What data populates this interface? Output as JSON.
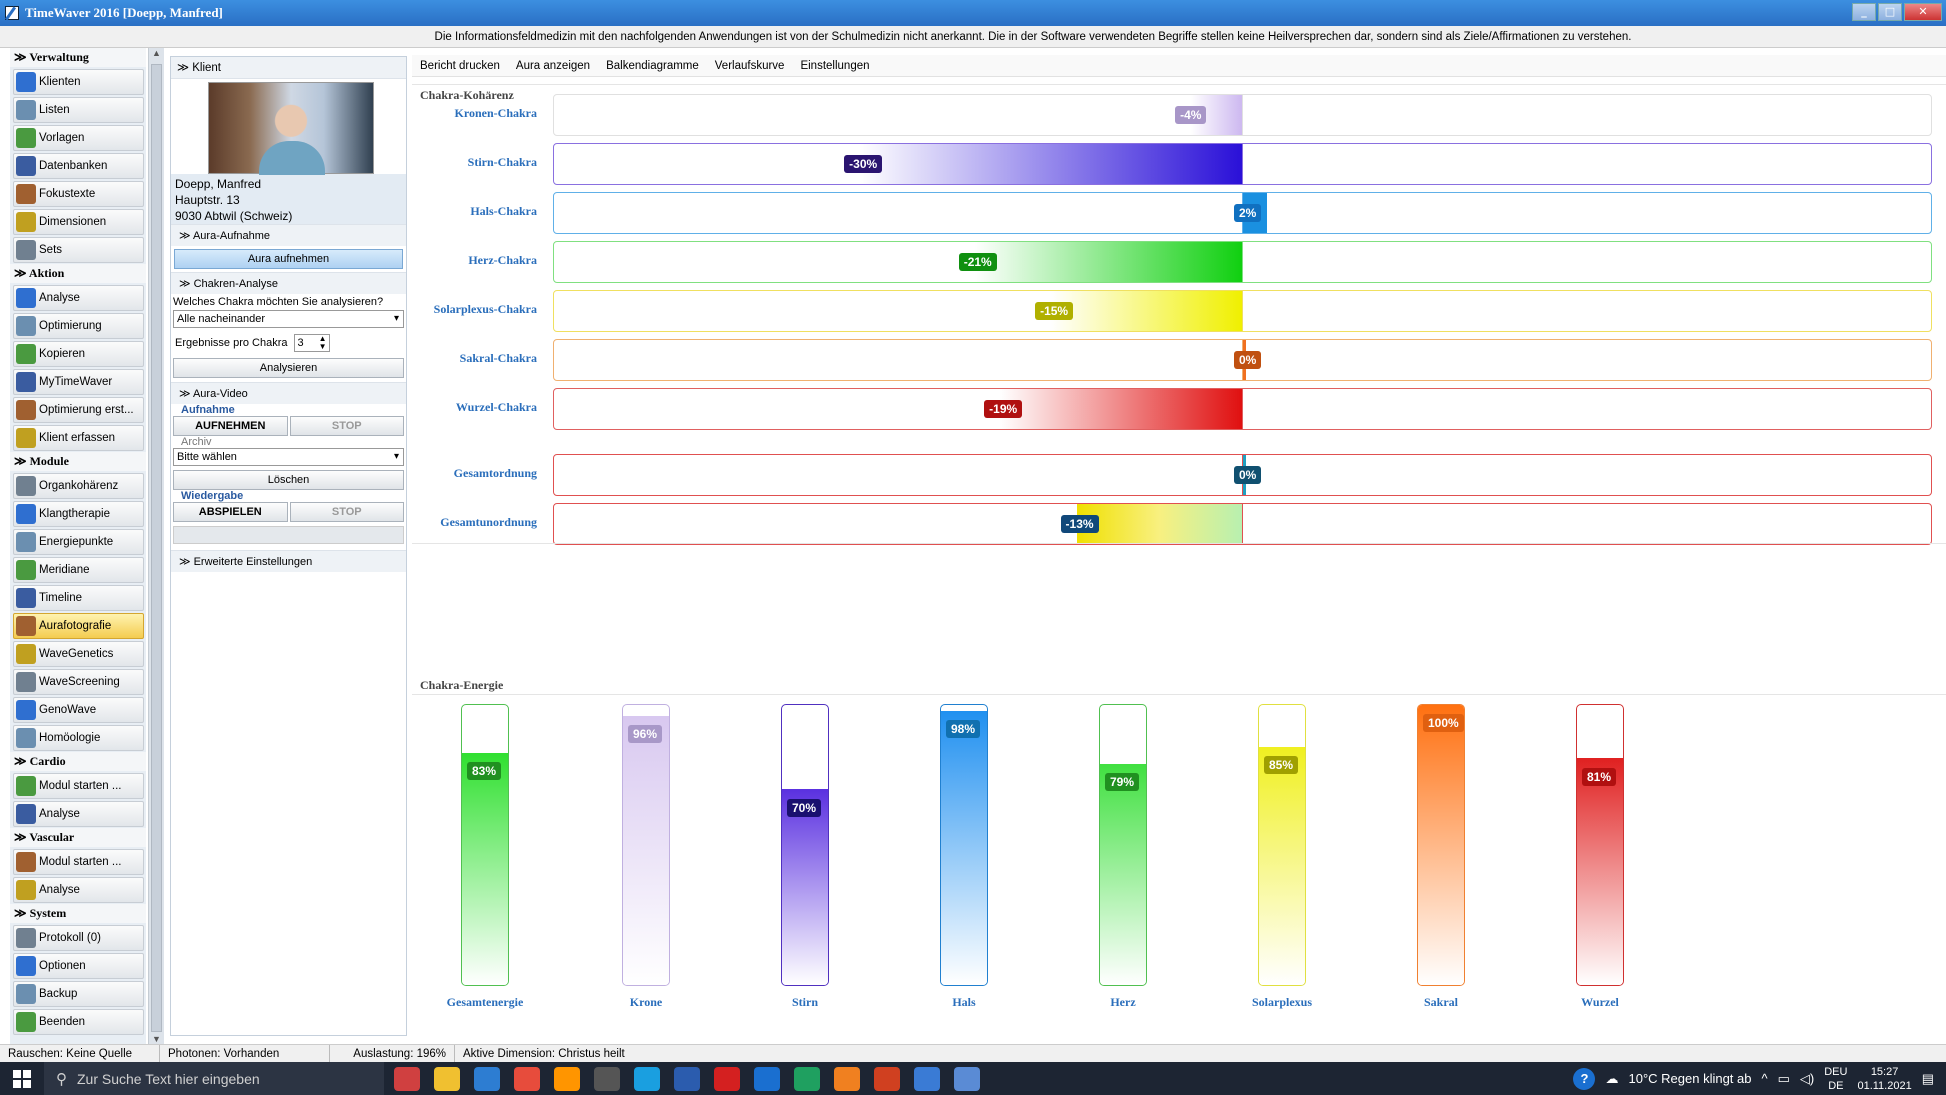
{
  "window": {
    "title": "TimeWaver 2016 [Doepp, Manfred]",
    "min": "_",
    "max": "□",
    "close": "✕"
  },
  "disclaimer": "Die Informationsfeldmedizin mit den nachfolgenden Anwendungen ist von der Schulmedizin nicht anerkannt. Die in der Software verwendeten Begriffe stellen keine Heilversprechen dar, sondern sind als Ziele/Affirmationen zu verstehen.",
  "nav": {
    "verwaltung": {
      "title": "Verwaltung",
      "items": [
        "Klienten",
        "Listen",
        "Vorlagen",
        "Datenbanken",
        "Fokustexte",
        "Dimensionen",
        "Sets"
      ]
    },
    "aktion": {
      "title": "Aktion",
      "items": [
        "Analyse",
        "Optimierung",
        "Kopieren",
        "MyTimeWaver",
        "Optimierung erst...",
        "Klient erfassen"
      ]
    },
    "module": {
      "title": "Module",
      "items": [
        "Organkohärenz",
        "Klangtherapie",
        "Energiepunkte",
        "Meridiane",
        "Timeline",
        "Aurafotografie",
        "WaveGenetics",
        "WaveScreening",
        "GenoWave",
        "Homöologie"
      ]
    },
    "cardio": {
      "title": "Cardio",
      "items": [
        "Modul starten ...",
        "Analyse"
      ]
    },
    "vascular": {
      "title": "Vascular",
      "items": [
        "Modul starten ...",
        "Analyse"
      ]
    },
    "system": {
      "title": "System",
      "items": [
        "Protokoll (0)",
        "Optionen",
        "Backup",
        "Beenden"
      ]
    },
    "icon_colors": [
      "#2f6fd0",
      "#6b8fb0",
      "#4a9a40",
      "#3a5ca0",
      "#a06030",
      "#c0a020",
      "#708090"
    ]
  },
  "klient": {
    "header": "Klient",
    "name": "Doepp, Manfred",
    "street": "Hauptstr. 13",
    "city": "9030 Abtwil (Schweiz)",
    "aura_aufnahme": "Aura-Aufnahme",
    "aura_button": "Aura aufnehmen",
    "chakren_analyse": "Chakren-Analyse",
    "question": "Welches Chakra möchten Sie analysieren?",
    "question_value": "Alle nacheinander",
    "ergebnisse_label": "Ergebnisse pro Chakra",
    "ergebnisse_value": "3",
    "analysieren": "Analysieren",
    "aura_video": "Aura-Video",
    "aufnahme_legend": "Aufnahme",
    "aufnehmen": "AUFNEHMEN",
    "stop": "STOP",
    "archiv_legend": "Archiv",
    "archiv_value": "Bitte wählen",
    "loeschen": "Löschen",
    "wiedergabe_legend": "Wiedergabe",
    "abspielen": "ABSPIELEN",
    "erweitert": "Erweiterte Einstellungen"
  },
  "toolbar": [
    "Bericht drucken",
    "Aura anzeigen",
    "Balkendiagramme",
    "Verlaufskurve",
    "Einstellungen"
  ],
  "chart_data": [
    {
      "type": "bar",
      "title": "Chakra-Kohärenz",
      "categories": [
        "Kronen-Chakra",
        "Stirn-Chakra",
        "Hals-Chakra",
        "Herz-Chakra",
        "Solarplexus-Chakra",
        "Sakral-Chakra",
        "Wurzel-Chakra",
        "Gesamtordnung",
        "Gesamtunordnung"
      ],
      "values": [
        -4,
        -30,
        2,
        -21,
        -15,
        0,
        -19,
        0,
        -13
      ],
      "labels": [
        "-4%",
        "-30%",
        "2%",
        "-21%",
        "-15%",
        "0%",
        "-19%",
        "0%",
        "-13%"
      ],
      "xlim": [
        -100,
        100
      ],
      "colors": [
        "#cdb8f0",
        "#2a10d8",
        "#1a90e0",
        "#10d010",
        "#f0f000",
        "#f07020",
        "#e01010",
        "#20a0c0",
        "#f0e000"
      ],
      "border_colors": [
        "#e0e0e0",
        "#8a70e0",
        "#60b0e8",
        "#80e080",
        "#f0e060",
        "#f0b070",
        "#e06060",
        "#e05050",
        "#e05050"
      ],
      "badge_colors": [
        "#a896c8",
        "#2a1470",
        "#1070c0",
        "#109010",
        "#b0b000",
        "#c05010",
        "#b01010",
        "#105070",
        "#10487a"
      ]
    },
    {
      "type": "bar",
      "title": "Chakra-Energie",
      "categories": [
        "Gesamtenergie",
        "Krone",
        "Stirn",
        "Hals",
        "Herz",
        "Solarplexus",
        "Sakral",
        "Wurzel"
      ],
      "values": [
        83,
        96,
        70,
        98,
        79,
        85,
        100,
        81
      ],
      "labels": [
        "83%",
        "96%",
        "70%",
        "98%",
        "79%",
        "85%",
        "100%",
        "81%"
      ],
      "ylim": [
        0,
        100
      ],
      "colors": [
        "#30e030",
        "#d8c8f0",
        "#5a30e0",
        "#2090f0",
        "#40e040",
        "#f0f020",
        "#ff7010",
        "#e02020"
      ],
      "border_colors": [
        "#50c050",
        "#c0b0e0",
        "#5030c0",
        "#2080d0",
        "#50c050",
        "#e0e040",
        "#f08030",
        "#d03030"
      ],
      "badge_colors": [
        "#209020",
        "#a898c8",
        "#1a1070",
        "#1070b0",
        "#209020",
        "#a0a000",
        "#e06010",
        "#b01010"
      ]
    }
  ],
  "status": {
    "rauschen": "Rauschen: Keine Quelle",
    "photonen": "Photonen: Vorhanden",
    "auslastung": "Auslastung: 196%",
    "dimension": "Aktive Dimension: Christus heilt"
  },
  "taskbar": {
    "search_placeholder": "Zur Suche Text hier eingeben",
    "weather": "10°C  Regen klingt ab",
    "lang1": "DEU",
    "lang2": "DE",
    "time": "15:27",
    "date": "01.11.2021",
    "app_colors": [
      "#d04040",
      "#f0c030",
      "#2d7dd2",
      "#e74c3c",
      "#ff9500",
      "#555",
      "#1a9fe0",
      "#2b5cae",
      "#d42020",
      "#1a6fd0",
      "#1fa060",
      "#f08020",
      "#d04020",
      "#3a7bd5",
      "#5a8bd5"
    ]
  }
}
